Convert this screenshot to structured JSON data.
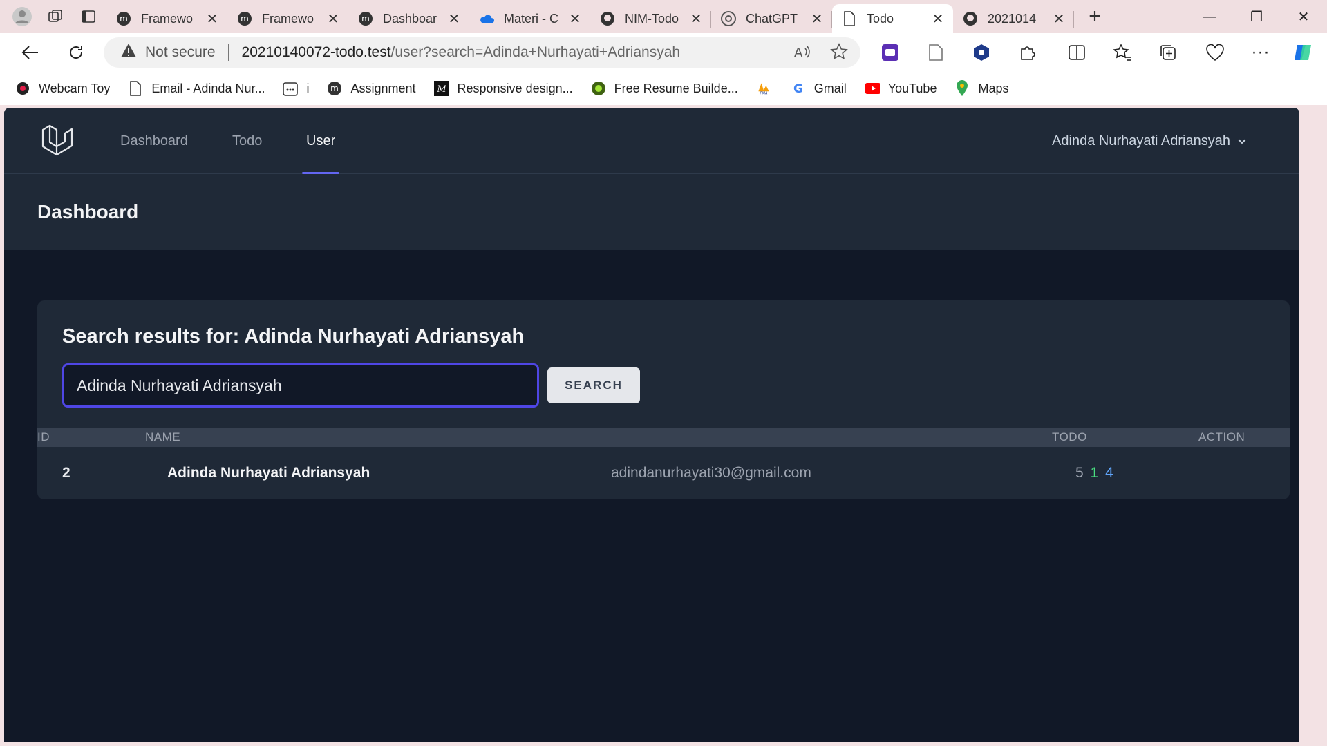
{
  "browser": {
    "tabs": [
      {
        "label": "Framewo",
        "favicon": "m-logo-icon"
      },
      {
        "label": "Framewo",
        "favicon": "m-logo-icon"
      },
      {
        "label": "Dashboar",
        "favicon": "m-logo-icon"
      },
      {
        "label": "Materi - C",
        "favicon": "onedrive-cloud-icon"
      },
      {
        "label": "NIM-Todo",
        "favicon": "github-icon"
      },
      {
        "label": "ChatGPT",
        "favicon": "chatgpt-icon"
      },
      {
        "label": "Todo",
        "favicon": "page-icon",
        "active": true
      },
      {
        "label": "2021014",
        "favicon": "github-icon"
      }
    ],
    "address": {
      "security": "Not secure",
      "host": "20210140072-todo.test",
      "path": "/user?search=Adinda+Nurhayati+Adriansyah"
    },
    "bookmarks": [
      {
        "label": "Webcam Toy",
        "icon": "webcam-icon"
      },
      {
        "label": "Email - Adinda Nur...",
        "icon": "page-icon"
      },
      {
        "label": "i",
        "icon": "calendar-icon"
      },
      {
        "label": "Assignment",
        "icon": "m-logo-icon"
      },
      {
        "label": "Responsive design...",
        "icon": "m-box-icon"
      },
      {
        "label": "Free Resume Builde...",
        "icon": "green-circle-icon"
      },
      {
        "label": "",
        "icon": "pma-icon"
      },
      {
        "label": "Gmail",
        "icon": "google-icon"
      },
      {
        "label": "YouTube",
        "icon": "youtube-icon"
      },
      {
        "label": "Maps",
        "icon": "maps-pin-icon"
      }
    ]
  },
  "app": {
    "nav": {
      "links": [
        {
          "label": "Dashboard"
        },
        {
          "label": "Todo"
        },
        {
          "label": "User",
          "active": true
        }
      ],
      "user_name": "Adinda Nurhayati Adriansyah"
    },
    "page_title": "Dashboard",
    "search": {
      "heading": "Search results for: Adinda Nurhayati Adriansyah",
      "value": "Adinda Nurhayati Adriansyah",
      "button_label": "SEARCH"
    },
    "table": {
      "headers": {
        "id": "ID",
        "name": "NAME",
        "todo": "TODO",
        "action": "ACTION"
      },
      "rows": [
        {
          "id": "2",
          "name": "Adinda Nurhayati Adriansyah",
          "email": "adindanurhayati30@gmail.com",
          "todo_total": "5",
          "todo_done": "1",
          "todo_pending": "4"
        }
      ]
    },
    "colors": {
      "accent": "#6366f1",
      "background": "#111827",
      "panel": "#1f2937",
      "todo_done": "#4ade80",
      "todo_pending": "#60a5fa"
    }
  }
}
